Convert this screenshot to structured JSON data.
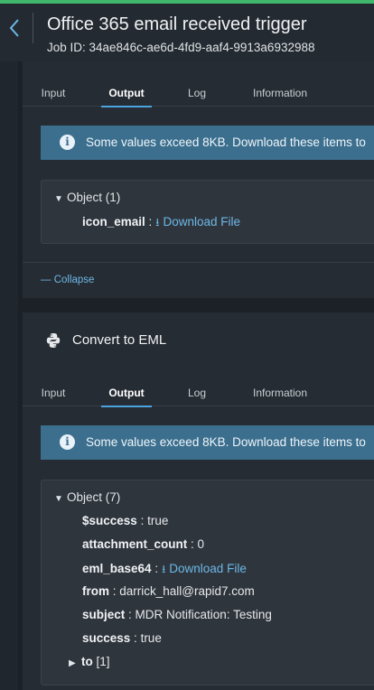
{
  "header": {
    "title": "Office 365 email received trigger",
    "job_id": "Job ID: 34ae846c-ae6d-4fd9-aaf4-9913a6932988"
  },
  "tabs": [
    "Input",
    "Output",
    "Log",
    "Information"
  ],
  "active_tab": "Output",
  "banner_text": "Some values exceed 8KB. Download these items to",
  "step1": {
    "object_label": "Object (1)",
    "rows": [
      {
        "key": "icon_email",
        "link": "Download File"
      }
    ],
    "collapse_label": "Collapse"
  },
  "step2": {
    "title": "Convert to EML",
    "object_label": "Object (7)",
    "rows": [
      {
        "key": "$success",
        "value": "true"
      },
      {
        "key": "attachment_count",
        "value": "0"
      },
      {
        "key": "eml_base64",
        "link": "Download File"
      },
      {
        "key": "from",
        "value": "darrick_hall@rapid7.com"
      },
      {
        "key": "subject",
        "value": "MDR Notification: Testing"
      },
      {
        "key": "success",
        "value": "true"
      }
    ],
    "to_key": "to",
    "to_value": "[1]"
  },
  "colors": {
    "accent": "#4ba3e0",
    "link": "#6cb8e6",
    "banner": "#3c6f8e",
    "top_line": "#3fb86b"
  },
  "icons": [
    "chevron-left-icon",
    "info-icon",
    "download-icon",
    "python-icon",
    "caret-down-icon",
    "caret-right-icon",
    "minus-icon"
  ]
}
